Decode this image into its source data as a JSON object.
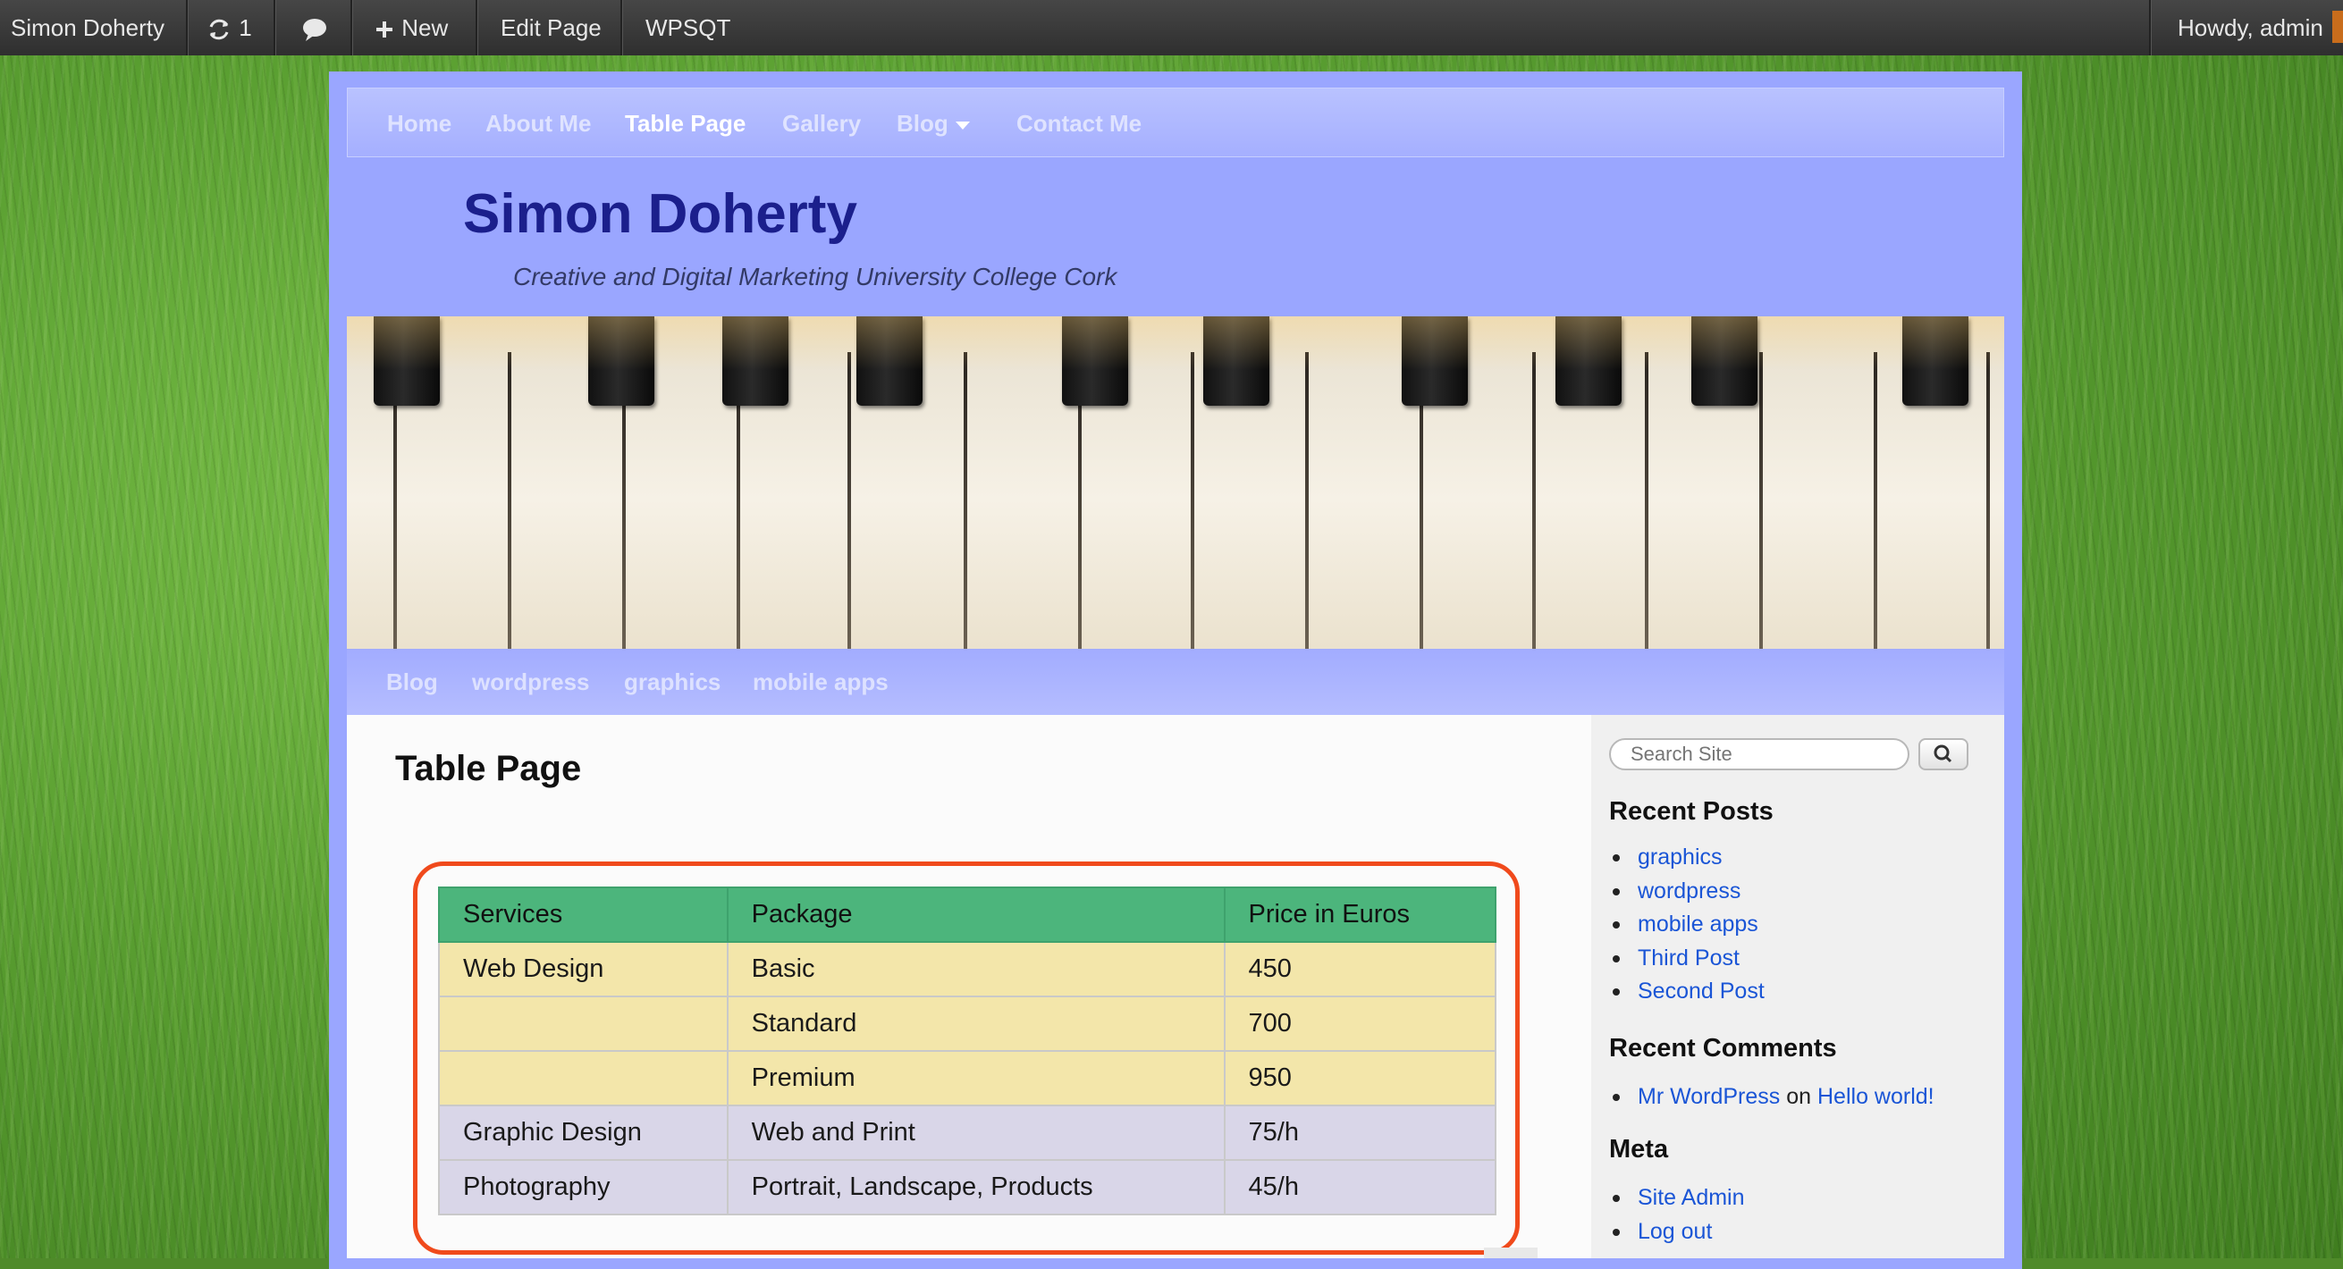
{
  "admin_bar": {
    "site_name": "Simon Doherty",
    "updates_count": "1",
    "new_label": "New",
    "edit_label": "Edit Page",
    "plugin_label": "WPSQT",
    "howdy": "Howdy, admin"
  },
  "top_nav": [
    "Home",
    "About Me",
    "Table Page",
    "Gallery",
    "Blog",
    "Contact Me"
  ],
  "site": {
    "title": "Simon Doherty",
    "description": "Creative and Digital Marketing University College Cork"
  },
  "sub_nav": [
    "Blog",
    "wordpress",
    "graphics",
    "mobile apps"
  ],
  "page": {
    "title": "Table Page",
    "table": {
      "headers": [
        "Services",
        "Package",
        "Price in Euros"
      ],
      "rows": [
        [
          "Web Design",
          "Basic",
          "450"
        ],
        [
          "",
          "Standard",
          "700"
        ],
        [
          "",
          "Premium",
          "950"
        ],
        [
          "Graphic Design",
          "Web and Print",
          "75/h"
        ],
        [
          "Photography",
          "Portrait, Landscape, Products",
          "45/h"
        ]
      ]
    }
  },
  "sidebar": {
    "search_placeholder": "Search Site",
    "recent_posts_title": "Recent Posts",
    "recent_posts": [
      "graphics",
      "wordpress",
      "mobile apps",
      "Third Post",
      "Second Post"
    ],
    "recent_comments_title": "Recent Comments",
    "comment_author": "Mr WordPress",
    "comment_on": "on",
    "comment_post": "Hello world!",
    "meta_title": "Meta",
    "meta_links": [
      "Site Admin",
      "Log out"
    ]
  },
  "colors": {
    "table_header": "#4cb57c",
    "table_row_yellow": "#f3e6aa",
    "table_row_lilac": "#d9d6e8",
    "highlight_outline": "#f04a1c",
    "page_frame": "#9aa6ff",
    "link": "#1a55d6"
  }
}
